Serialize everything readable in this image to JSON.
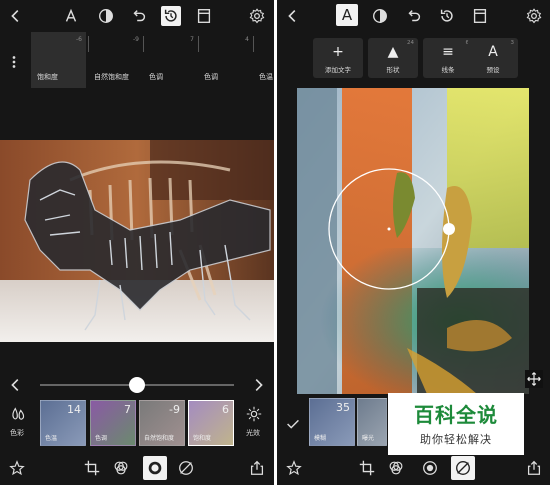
{
  "left": {
    "badges": {
      "undo_count": "",
      "history_count": ""
    },
    "adjustments": [
      {
        "label": "饱和度",
        "value": "-6"
      },
      {
        "label": "自然饱和度",
        "value": "-9"
      },
      {
        "label": "色调",
        "value": "7"
      },
      {
        "label": "色调",
        "value": "4"
      },
      {
        "label": "色温",
        "value": ""
      }
    ],
    "slider": {
      "value": 0.5
    },
    "side_left_label": "色彩",
    "side_right_label": "光效",
    "filters": [
      {
        "value": "14",
        "label": "色温",
        "color": "#6d82a6"
      },
      {
        "value": "7",
        "label": "色调",
        "color": "#a06ab0"
      },
      {
        "value": "-9",
        "label": "自然饱和度",
        "color": "#8c8c8c"
      },
      {
        "value": "6",
        "label": "饱和度",
        "color": "#b9a0c8"
      }
    ]
  },
  "right": {
    "text_icon_label": "A",
    "tools": [
      {
        "icon": "+",
        "label": "添加文字",
        "count": ""
      },
      {
        "icon": "▲",
        "label": "形状",
        "count": "24"
      },
      {
        "icon": "≡",
        "label": "线条",
        "count": "6"
      },
      {
        "icon": "A",
        "label": "预设",
        "count": "3"
      }
    ],
    "filters": [
      {
        "value": "35",
        "label": "模糊",
        "color": "#6b7da0"
      },
      {
        "value": "",
        "label": "曝光",
        "color": "#7d8a99"
      }
    ]
  },
  "watermark": {
    "title": "百科全说",
    "subtitle": "助你轻松解决",
    "color": "#1d8a3a"
  }
}
